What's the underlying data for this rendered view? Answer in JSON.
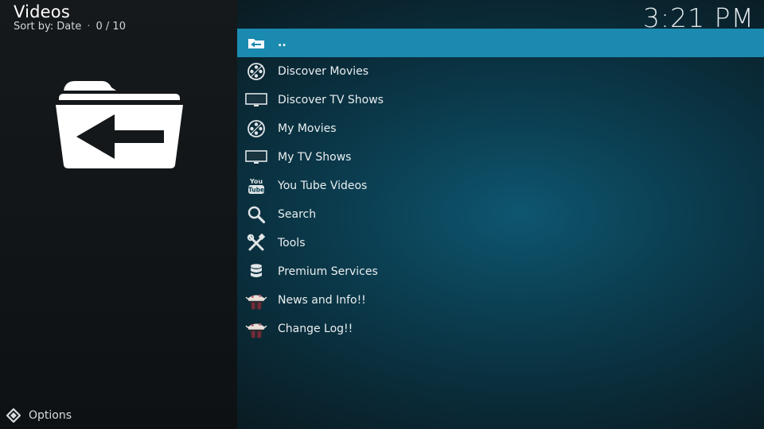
{
  "header": {
    "title": "Videos",
    "sort_label": "Sort by: Date",
    "separator": "·",
    "count": "0 / 10"
  },
  "clock": "3:21 PM",
  "footer": {
    "options_label": "Options"
  },
  "list": {
    "items": [
      {
        "label": "..",
        "icon": "folder-back-icon",
        "selected": true
      },
      {
        "label": "Discover Movies",
        "icon": "film-reel-icon"
      },
      {
        "label": "Discover TV Shows",
        "icon": "tv-icon"
      },
      {
        "label": "My Movies",
        "icon": "film-reel-icon"
      },
      {
        "label": "My TV Shows",
        "icon": "tv-icon"
      },
      {
        "label": "You Tube Videos",
        "icon": "youtube-icon"
      },
      {
        "label": "Search",
        "icon": "search-icon"
      },
      {
        "label": "Tools",
        "icon": "tools-icon"
      },
      {
        "label": "Premium Services",
        "icon": "database-icon"
      },
      {
        "label": "News and Info!!",
        "icon": "addon-logo-icon"
      },
      {
        "label": "Change Log!!",
        "icon": "addon-logo-icon"
      }
    ]
  },
  "youtube_icon_text": {
    "top": "You",
    "bottom": "Tube"
  },
  "colors": {
    "selection": "#1b8ab0",
    "background": "#0b3f52",
    "left_panel": "#131719"
  }
}
